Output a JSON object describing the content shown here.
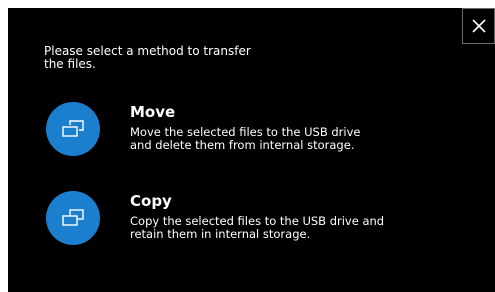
{
  "dialog": {
    "prompt": "Please select a method to transfer\nthe files.",
    "close_icon": "close-icon",
    "options": [
      {
        "title": "Move",
        "description": "Move the selected files to the USB drive\nand delete them from internal storage.",
        "icon": "move-icon"
      },
      {
        "title": "Copy",
        "description": "Copy the selected files to the USB drive and\nretain them in internal storage.",
        "icon": "copy-icon"
      }
    ]
  },
  "colors": {
    "background": "#000000",
    "accent": "#1b7fce",
    "text": "#ffffff"
  }
}
